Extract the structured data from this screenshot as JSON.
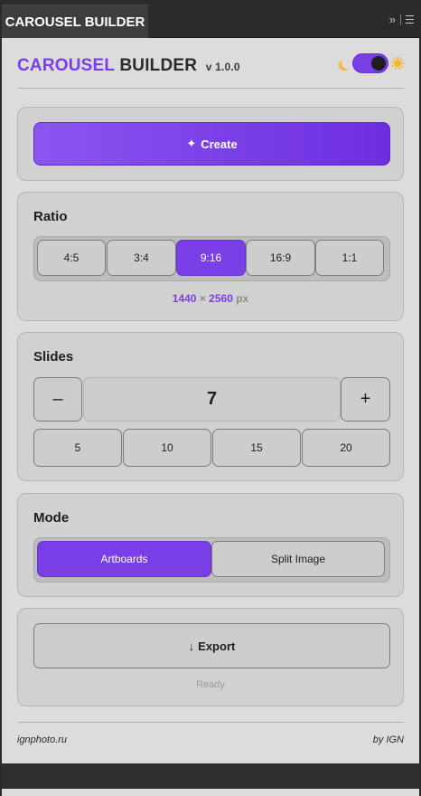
{
  "tab": {
    "title": "CAROUSEL BUILDER",
    "expand_glyph": "»"
  },
  "header": {
    "brand_accent": "CAROUSEL",
    "brand_rest": "BUILDER",
    "version": "v 1.0.0",
    "theme_toggle_on": true
  },
  "create": {
    "icon": "✦",
    "label": "Create"
  },
  "ratio": {
    "title": "Ratio",
    "options": [
      "4:5",
      "3:4",
      "9:16",
      "16:9",
      "1:1"
    ],
    "selected": "9:16",
    "width": "1440",
    "times": "×",
    "height": "2560",
    "unit": "px"
  },
  "slides": {
    "title": "Slides",
    "minus": "–",
    "value": "7",
    "plus": "+",
    "presets": [
      "5",
      "10",
      "15",
      "20"
    ]
  },
  "mode": {
    "title": "Mode",
    "options": [
      "Artboards",
      "Split Image"
    ],
    "selected": "Artboards"
  },
  "export": {
    "icon": "↓",
    "label": "Export",
    "status": "Ready"
  },
  "footer": {
    "site": "ignphoto.ru",
    "credit": "by IGN"
  },
  "colors": {
    "accent": "#7a3ee6",
    "panel": "#dcdcdc",
    "card": "#d1d1d1",
    "chrome": "#2b2b2b"
  }
}
